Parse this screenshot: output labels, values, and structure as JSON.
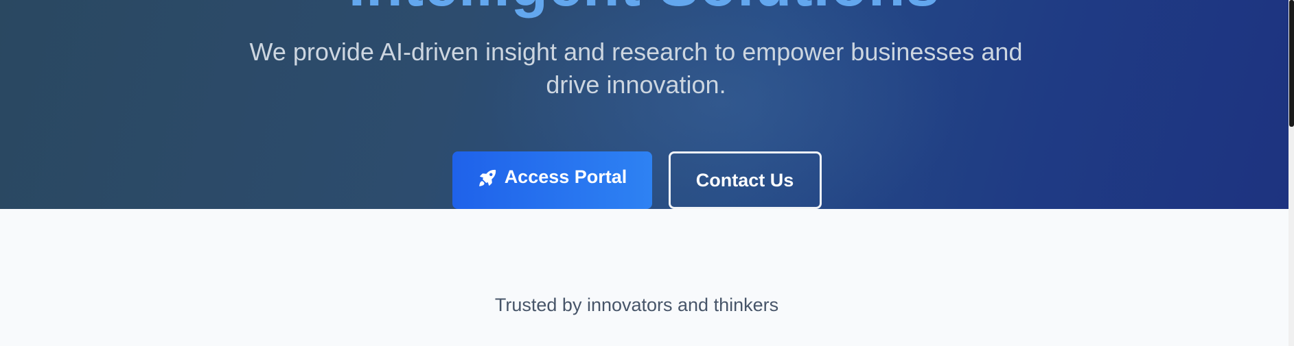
{
  "hero": {
    "title": "Intelligent Solutions",
    "subtitle": "We provide AI-driven insight and research to empower businesses and drive innovation.",
    "primary_button": {
      "label": "Access Portal",
      "icon": "rocket-icon"
    },
    "secondary_button": {
      "label": "Contact Us"
    }
  },
  "trusted": {
    "text": "Trusted by innovators and thinkers"
  },
  "colors": {
    "title_accent": "#63a7ee",
    "primary_button": "#2e82f3",
    "page_background": "#f8fafc"
  }
}
